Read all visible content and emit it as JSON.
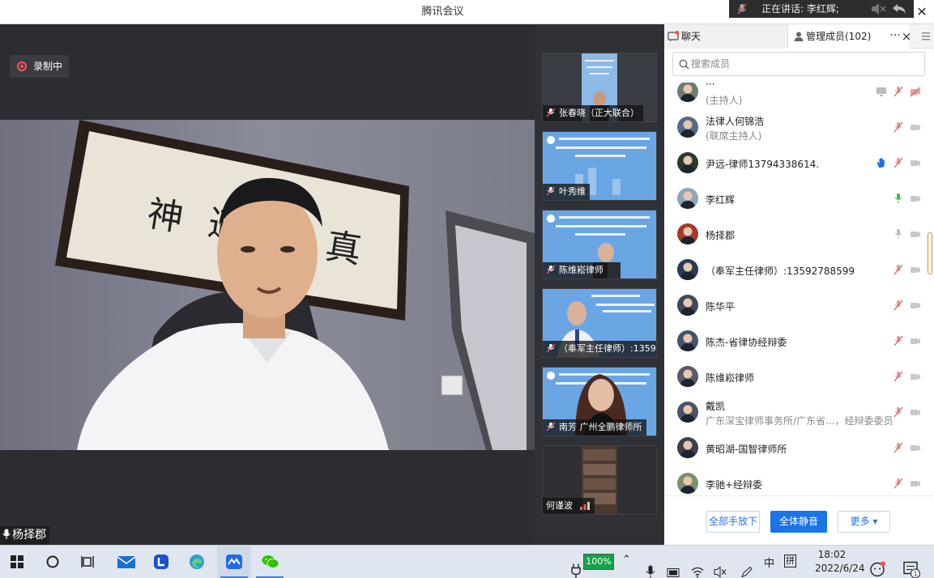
{
  "window": {
    "title": "腾讯会议",
    "speaking_now": "正在讲话: 李红辉;"
  },
  "main": {
    "recording_label": "录制中",
    "speaker_name": "杨择郡"
  },
  "thumbnails": [
    {
      "name": "张春晓（正大联合）"
    },
    {
      "name": "叶秀维"
    },
    {
      "name": "陈维崧律师"
    },
    {
      "name": "（奉军主任律师）:13592..."
    },
    {
      "name": "南芳  广州全鹏律师所"
    },
    {
      "name": "何谨波"
    }
  ],
  "panel": {
    "tab_chat": "聊天",
    "tab_members": "管理成员(102)",
    "more_label": "···",
    "close_label": "×",
    "search_placeholder": "搜索成员",
    "members": [
      {
        "name": "···",
        "sub": "(主持人)",
        "mic": "muted",
        "extra": "share"
      },
      {
        "name": "法律人何锦浩",
        "sub": "(联席主持人)",
        "mic": "muted"
      },
      {
        "name": "尹远-律师13794338614.",
        "sub": "",
        "mic": "muted",
        "extra": "hand"
      },
      {
        "name": "李红辉",
        "sub": "",
        "mic": "active"
      },
      {
        "name": "杨择郡",
        "sub": "",
        "mic": "on"
      },
      {
        "name": "（奉军主任律师）:13592788599",
        "sub": "",
        "mic": "muted"
      },
      {
        "name": "陈华平",
        "sub": "",
        "mic": "muted"
      },
      {
        "name": "陈杰-省律协经辩委",
        "sub": "",
        "mic": "muted"
      },
      {
        "name": "陈维崧律师",
        "sub": "",
        "mic": "muted"
      },
      {
        "name": "戴凯",
        "sub": "广东深宝律师事务所/广东省...，经辩委委员",
        "mic": "muted"
      },
      {
        "name": "黄昭湖-国智律师所",
        "sub": "",
        "mic": "muted"
      },
      {
        "name": "李驰+经辩委",
        "sub": "",
        "mic": "muted"
      }
    ],
    "btn_lower_all": "全部手放下",
    "btn_mute_all": "全体静音",
    "btn_more": "更多 ▾"
  },
  "taskbar": {
    "battery": "100%",
    "ime": "中",
    "ime2": "拼",
    "time": "18:02",
    "date": "2022/6/24",
    "notification_count": "1"
  },
  "colors": {
    "accent": "#1b73e8",
    "muted_red": "#e06060",
    "active_green": "#3cc13b",
    "record_red": "#ff5252"
  }
}
